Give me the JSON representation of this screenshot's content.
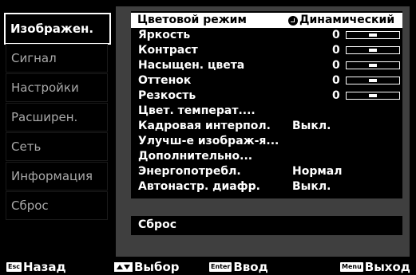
{
  "sidebar": {
    "items": [
      {
        "label": "Изображен.",
        "active": true
      },
      {
        "label": "Сигнал"
      },
      {
        "label": "Настройки"
      },
      {
        "label": "Расширен."
      },
      {
        "label": "Сеть"
      },
      {
        "label": "Информация"
      },
      {
        "label": "Сброс"
      }
    ]
  },
  "menu": {
    "rows": [
      {
        "label": "Цветовой режим",
        "value": "Динамический",
        "selected": true
      },
      {
        "label": "Яркость",
        "num": "0",
        "slider_level": 0.5
      },
      {
        "label": "Контраст",
        "num": "0",
        "slider_level": 0.5
      },
      {
        "label": "Насыщен. цвета",
        "num": "0",
        "slider_level": 0.5
      },
      {
        "label": "Оттенок",
        "num": "0",
        "slider_level": 0.5
      },
      {
        "label": "Резкость",
        "num": "0",
        "slider_level": 0.5
      },
      {
        "label": "Цвет. температ...."
      },
      {
        "label": "Кадровая интерпол.",
        "value": "Выкл."
      },
      {
        "label": "Улучш-е изображ-я..."
      },
      {
        "label": "Дополнительно..."
      },
      {
        "label": "Энергопотребл.",
        "value": "Нормал"
      },
      {
        "label": "Автонастр. диафр.",
        "value": "Выкл."
      }
    ],
    "reset_label": "Сброс"
  },
  "footer": {
    "back": {
      "key": "Esc",
      "label": "Назад"
    },
    "select": {
      "label": "Выбор"
    },
    "enter": {
      "key": "Enter",
      "label": "Ввод"
    },
    "exit": {
      "key": "Menu",
      "label": "Выход"
    }
  },
  "colors": {
    "panel": "#3f3f3f",
    "inactive_text": "#a9a9a9",
    "highlight": "#ffffff"
  }
}
